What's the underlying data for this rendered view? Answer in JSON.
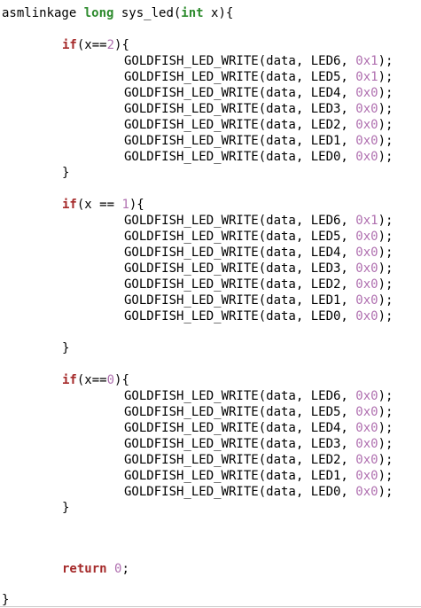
{
  "code": {
    "signature": {
      "prefix": "asmlinkage ",
      "ret_type": "long",
      "name": " sys_led(",
      "param_type": "int",
      "rest": " x){"
    },
    "blocks": [
      {
        "if_kw": "if",
        "cond_open": "(x==",
        "cond_num": "2",
        "cond_close": "){",
        "calls": [
          {
            "prefix": "GOLDFISH_LED_WRITE(data, LED6, ",
            "value": "0x1",
            "suffix": ");"
          },
          {
            "prefix": "GOLDFISH_LED_WRITE(data, LED5, ",
            "value": "0x1",
            "suffix": ");"
          },
          {
            "prefix": "GOLDFISH_LED_WRITE(data, LED4, ",
            "value": "0x0",
            "suffix": ");"
          },
          {
            "prefix": "GOLDFISH_LED_WRITE(data, LED3, ",
            "value": "0x0",
            "suffix": ");"
          },
          {
            "prefix": "GOLDFISH_LED_WRITE(data, LED2, ",
            "value": "0x0",
            "suffix": ");"
          },
          {
            "prefix": "GOLDFISH_LED_WRITE(data, LED1, ",
            "value": "0x0",
            "suffix": ");"
          },
          {
            "prefix": "GOLDFISH_LED_WRITE(data, LED0, ",
            "value": "0x0",
            "suffix": ");"
          }
        ],
        "close": "}"
      },
      {
        "if_kw": "if",
        "cond_open": "(x == ",
        "cond_num": "1",
        "cond_close": "){",
        "calls": [
          {
            "prefix": "GOLDFISH_LED_WRITE(data, LED6, ",
            "value": "0x1",
            "suffix": ");"
          },
          {
            "prefix": "GOLDFISH_LED_WRITE(data, LED5, ",
            "value": "0x0",
            "suffix": ");"
          },
          {
            "prefix": "GOLDFISH_LED_WRITE(data, LED4, ",
            "value": "0x0",
            "suffix": ");"
          },
          {
            "prefix": "GOLDFISH_LED_WRITE(data, LED3, ",
            "value": "0x0",
            "suffix": ");"
          },
          {
            "prefix": "GOLDFISH_LED_WRITE(data, LED2, ",
            "value": "0x0",
            "suffix": ");"
          },
          {
            "prefix": "GOLDFISH_LED_WRITE(data, LED1, ",
            "value": "0x0",
            "suffix": ");"
          },
          {
            "prefix": "GOLDFISH_LED_WRITE(data, LED0, ",
            "value": "0x0",
            "suffix": ");"
          }
        ],
        "close": "}"
      },
      {
        "if_kw": "if",
        "cond_open": "(x==",
        "cond_num": "0",
        "cond_close": "){",
        "calls": [
          {
            "prefix": "GOLDFISH_LED_WRITE(data, LED6, ",
            "value": "0x0",
            "suffix": ");"
          },
          {
            "prefix": "GOLDFISH_LED_WRITE(data, LED5, ",
            "value": "0x0",
            "suffix": ");"
          },
          {
            "prefix": "GOLDFISH_LED_WRITE(data, LED4, ",
            "value": "0x0",
            "suffix": ");"
          },
          {
            "prefix": "GOLDFISH_LED_WRITE(data, LED3, ",
            "value": "0x0",
            "suffix": ");"
          },
          {
            "prefix": "GOLDFISH_LED_WRITE(data, LED2, ",
            "value": "0x0",
            "suffix": ");"
          },
          {
            "prefix": "GOLDFISH_LED_WRITE(data, LED1, ",
            "value": "0x0",
            "suffix": ");"
          },
          {
            "prefix": "GOLDFISH_LED_WRITE(data, LED0, ",
            "value": "0x0",
            "suffix": ");"
          }
        ],
        "close": "}"
      }
    ],
    "return_stmt": {
      "kw": "return",
      "space": " ",
      "value": "0",
      "semi": ";"
    },
    "function_close": "}"
  },
  "colors": {
    "type_keyword": "#2e8b2e",
    "control_keyword": "#a52a2a",
    "number_literal": "#b070b0",
    "text": "#000000",
    "background": "#ffffff"
  }
}
